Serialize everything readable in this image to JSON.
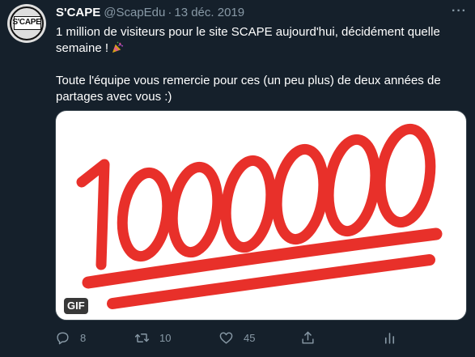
{
  "tweet": {
    "avatar_text": "S'CAPE",
    "author_name": "S'CAPE",
    "handle": "@ScapEdu",
    "separator": "·",
    "date": "13 déc. 2019",
    "more_label": "···",
    "text_line1": "1 million de visiteurs pour le site SCAPE aujourd'hui, décidément quelle semaine ! ",
    "text_line2": "Toute l'équipe vous remercie pour ces (un peu plus) de deux années de partages avec vous :)",
    "emoji": "party-popper",
    "media": {
      "type": "gif",
      "badge": "GIF",
      "content": "1000000",
      "underline_color": "#e8302a"
    },
    "actions": {
      "reply_count": "8",
      "retweet_count": "10",
      "like_count": "45"
    }
  },
  "colors": {
    "background": "#15202b",
    "secondary_text": "#8899a6",
    "primary_text": "#ffffff",
    "border": "#38444d",
    "accent_red": "#e8302a"
  }
}
